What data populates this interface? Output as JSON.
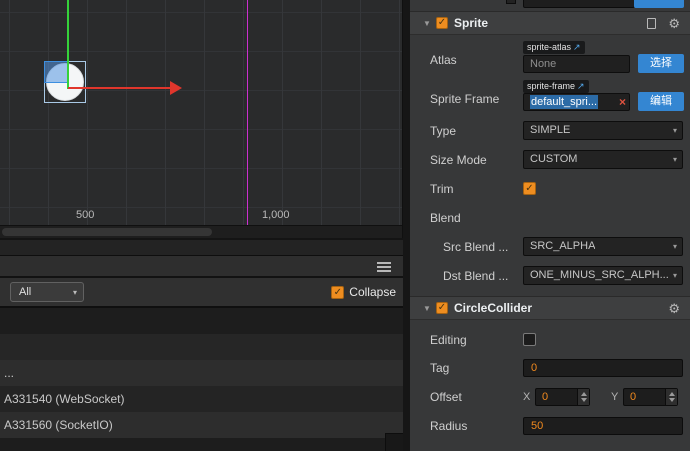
{
  "colors": {
    "accent_orange": "#ee8d20",
    "value_orange": "#f28a1e",
    "button_blue": "#3486d2",
    "selection_blue": "#2c6ba6",
    "error_red": "#e05340",
    "gizmo_green": "#35d23a",
    "gizmo_red": "#e0362c",
    "canvas_magenta": "#cc2fcf"
  },
  "icons": {
    "caret_down": "▾",
    "section_collapse": "▼",
    "check": "✓",
    "external_link": "↗",
    "close": "×",
    "gear": "⚙"
  },
  "scene": {
    "ruler_labels": [
      "500",
      "1,000"
    ]
  },
  "console": {
    "filter_label": "All",
    "collapse_label": "Collapse",
    "rows": [
      "",
      "",
      "...",
      "A331540 (WebSocket)",
      "A331560 (SocketIO)"
    ]
  },
  "inspector": {
    "sprite": {
      "title": "Sprite",
      "atlas": {
        "label": "Atlas",
        "chip": "sprite-atlas",
        "value": "None",
        "button": "选择"
      },
      "sprite_frame": {
        "label": "Sprite Frame",
        "chip": "sprite-frame",
        "value": "default_spri...",
        "button": "编辑"
      },
      "type": {
        "label": "Type",
        "value": "SIMPLE"
      },
      "size_mode": {
        "label": "Size Mode",
        "value": "CUSTOM"
      },
      "trim": {
        "label": "Trim"
      },
      "blend_label": "Blend",
      "src_blend": {
        "label": "Src Blend ...",
        "value": "SRC_ALPHA"
      },
      "dst_blend": {
        "label": "Dst Blend ...",
        "value": "ONE_MINUS_SRC_ALPH..."
      }
    },
    "circle_collider": {
      "title": "CircleCollider",
      "editing_label": "Editing",
      "tag": {
        "label": "Tag",
        "value": "0"
      },
      "offset": {
        "label": "Offset",
        "x_label": "X",
        "x_value": "0",
        "y_label": "Y",
        "y_value": "0"
      },
      "radius": {
        "label": "Radius",
        "value": "50"
      }
    }
  }
}
